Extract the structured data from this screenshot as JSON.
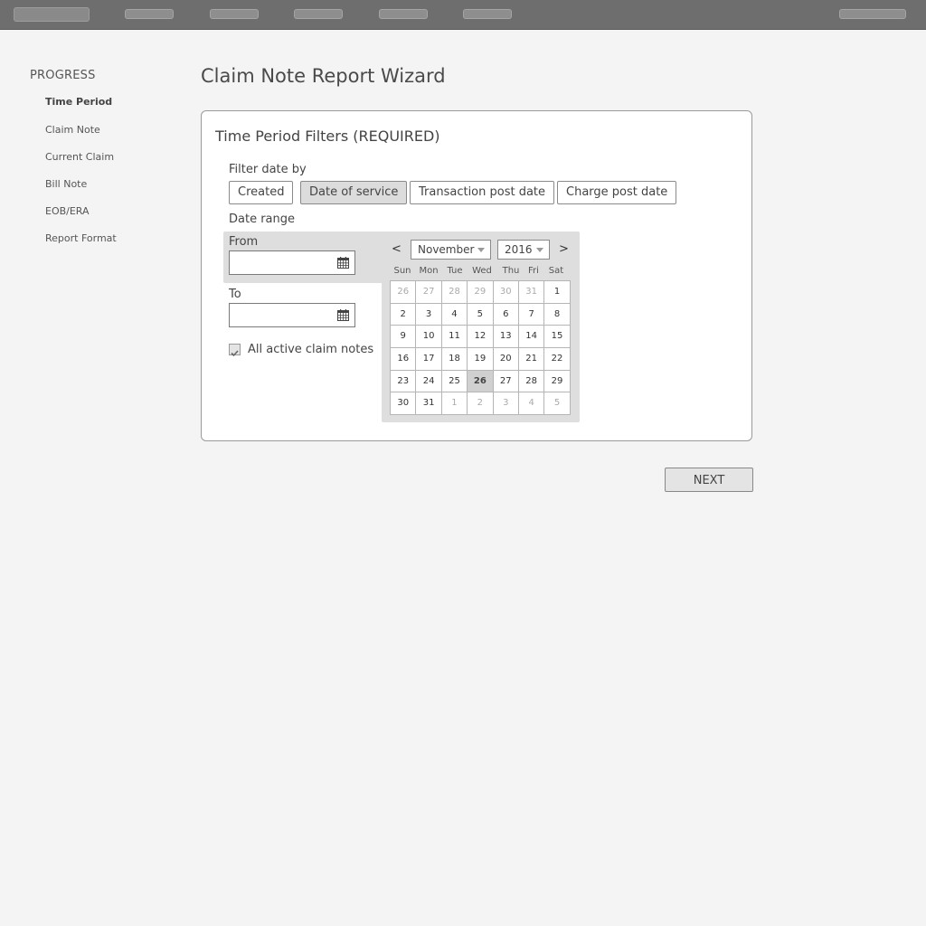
{
  "sidebar": {
    "title": "PROGRESS",
    "items": [
      {
        "label": "Time Period"
      },
      {
        "label": "Claim Note"
      },
      {
        "label": "Current Claim"
      },
      {
        "label": "Bill Note"
      },
      {
        "label": "EOB/ERA"
      },
      {
        "label": "Report Format"
      }
    ],
    "active_index": 0
  },
  "page": {
    "title": "Claim Note Report Wizard"
  },
  "card": {
    "title": "Time Period Filters (REQUIRED)",
    "filter_label": "Filter date by",
    "filter_options": [
      {
        "label": "Created"
      },
      {
        "label": "Date of service"
      },
      {
        "label": "Transaction post date"
      },
      {
        "label": "Charge post date"
      }
    ],
    "selected_filter": "Date of service",
    "date_range_label": "Date range",
    "from_label": "From",
    "to_label": "To",
    "from_value": "",
    "to_value": "",
    "checkbox_label": "All active claim notes",
    "checkbox_checked": true
  },
  "calendar": {
    "prev": "<",
    "next": ">",
    "month": "November",
    "year": "2016",
    "weekdays": [
      "Sun",
      "Mon",
      "Tue",
      "Wed",
      "Thu",
      "Fri",
      "Sat"
    ],
    "days": [
      "26",
      "27",
      "28",
      "29",
      "30",
      "31",
      "1",
      "2",
      "3",
      "4",
      "5",
      "6",
      "7",
      "8",
      "9",
      "10",
      "11",
      "12",
      "13",
      "14",
      "15",
      "16",
      "17",
      "18",
      "19",
      "20",
      "21",
      "22",
      "23",
      "24",
      "25",
      "26",
      "27",
      "28",
      "29",
      "30",
      "31",
      "1",
      "2",
      "3",
      "4",
      "5"
    ],
    "selected_day": "26"
  },
  "actions": {
    "next_label": "NEXT"
  },
  "colors": {
    "topbar": "#6e6e6e",
    "background": "#f4f4f4",
    "selected": "#dcdcdc"
  }
}
